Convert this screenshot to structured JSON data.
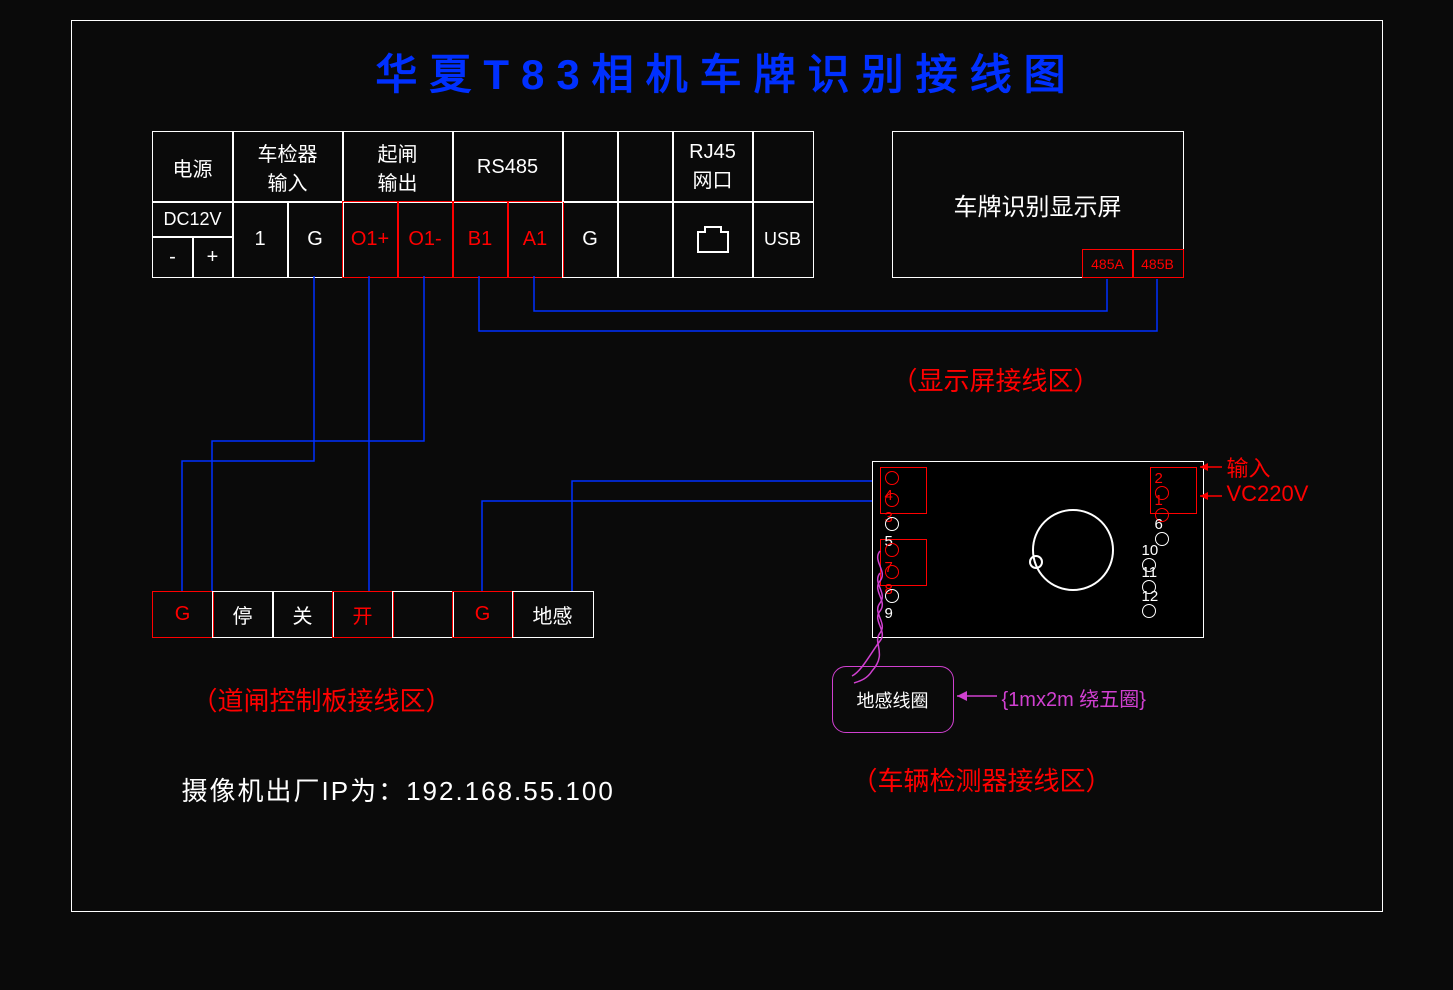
{
  "title": "华夏T83相机车牌识别接线图",
  "top": {
    "headers": {
      "power": "电源",
      "detector": "车检器\n输入",
      "gate": "起闸\n输出",
      "rs485": "RS485",
      "rj45": "RJ45\n网口"
    },
    "row": {
      "dc": "DC12V",
      "minus": "-",
      "plus": "+",
      "one": "1",
      "g1": "G",
      "o1p": "O1+",
      "o1m": "O1-",
      "b1": "B1",
      "a1": "A1",
      "g2": "G",
      "usb": "USB"
    }
  },
  "display": {
    "label": "车牌识别显示屏",
    "p1": "485A",
    "p2": "485B",
    "zone": "（显示屏接线区）"
  },
  "gate_ctrl": {
    "g": "G",
    "stop": "停",
    "close": "关",
    "open": "开",
    "g2": "G",
    "sense": "地感",
    "zone": "（道闸控制板接线区）"
  },
  "detector": {
    "left": {
      "p4": "4",
      "p3": "3",
      "p5": "5",
      "p7": "7",
      "p8": "8",
      "p9": "9"
    },
    "right": {
      "p2": "2",
      "p1": "1",
      "p6": "6",
      "p10": "10",
      "p11": "11",
      "p12": "12"
    },
    "input": "输入",
    "vc": "VC220V",
    "coil": "地感线圈",
    "coil_note": "{1mx2m 绕五圈}",
    "zone": "（车辆检测器接线区）"
  },
  "ip": "摄像机出厂IP为：192.168.55.100"
}
